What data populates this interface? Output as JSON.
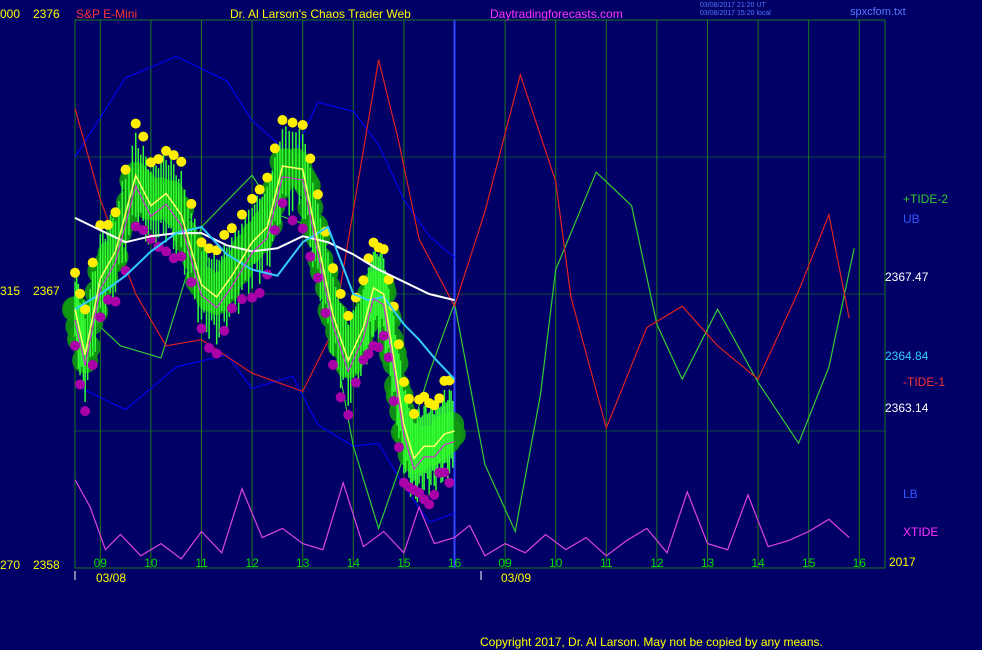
{
  "header": {
    "y_top_left": "000",
    "y_top_price": "2376",
    "instrument": "S&P E-Mini",
    "app_title": "Dr. Al Larson's Chaos Trader Web",
    "site": "Daytradingforecasts.com",
    "stamp_line1": "03/08/2017 21:20 UT",
    "stamp_line2": "03/08/2017 15:20 local",
    "file_name": "spxcfom.txt"
  },
  "y_axis_left": {
    "mid_left": "315",
    "mid_price": "2367",
    "bottom_left": "270",
    "bottom_price": "2358"
  },
  "right_labels": {
    "tide2": "+TIDE-2",
    "ub": "UB",
    "price_a": "2367.47",
    "price_b": "2364.84",
    "tide1": "-TIDE-1",
    "price_c": "2363.14",
    "lb": "LB",
    "xtide": "XTIDE",
    "year": "2017"
  },
  "x_axis": {
    "hours": [
      "09",
      "10",
      "11",
      "12",
      "13",
      "14",
      "15",
      "16",
      "09",
      "10",
      "11",
      "12",
      "13",
      "14",
      "15",
      "16"
    ],
    "dates": [
      "03/08",
      "03/09"
    ]
  },
  "footer": {
    "copyright": "Copyright 2017, Dr. Al Larson. May not be copied by any means."
  },
  "colors": {
    "background": "#000066",
    "grid": "#1a7a1a",
    "price_bar": "#33ff33",
    "price_glow": "#119911",
    "high_dot": "#ffee00",
    "low_dot": "#aa00aa",
    "price_line": "#ffff66",
    "midline": "#cc33cc",
    "cyan_ma": "#33ccff",
    "white_ma": "#ffffff",
    "tide2": "#33cc33",
    "tide1": "#dd2222",
    "bands": "#0000ee",
    "xtide": "#dd44dd",
    "divider": "#3344ff"
  },
  "chart_data": {
    "type": "line",
    "title": "S&P E-Mini",
    "xlabel": "",
    "ylabel": "",
    "ylim": [
      2358,
      2376
    ],
    "x_ticks": [
      "09",
      "10",
      "11",
      "12",
      "13",
      "14",
      "15",
      "16",
      "09",
      "10",
      "11",
      "12",
      "13",
      "14",
      "15",
      "16"
    ],
    "price_readouts": [
      2367.47,
      2364.84,
      2363.14
    ],
    "series": [
      {
        "name": "+TIDE-2",
        "x": [
          8.5,
          9.4,
          10.2,
          11.0,
          12.0,
          12.5,
          13.2,
          14.0,
          14.5,
          15.0,
          15.5,
          16.0,
          16.6,
          17.2,
          17.7,
          18.0,
          18.8,
          19.5,
          20.0,
          20.5,
          21.2,
          22.0,
          22.8,
          23.4,
          23.9
        ],
        "y": [
          2366.7,
          2365.3,
          2364.9,
          2369.2,
          2370.9,
          2369.6,
          2369.2,
          2362.0,
          2359.3,
          2361.7,
          2364.4,
          2366.7,
          2361.4,
          2359.2,
          2363.7,
          2367.8,
          2371.0,
          2369.9,
          2366.0,
          2364.2,
          2366.5,
          2364.1,
          2362.1,
          2364.6,
          2368.5
        ]
      },
      {
        "name": "-TIDE-1",
        "x": [
          8.5,
          9.0,
          9.7,
          10.3,
          11.0,
          12.0,
          13.0,
          13.6,
          14.5,
          14.9,
          15.3,
          16.0,
          16.6,
          17.3,
          18.0,
          18.3,
          19.0,
          19.8,
          20.5,
          21.2,
          22.0,
          22.8,
          23.4,
          23.8
        ],
        "y": [
          2373.1,
          2370.1,
          2367.0,
          2365.3,
          2365.5,
          2364.4,
          2363.8,
          2365.8,
          2374.7,
          2372.0,
          2368.8,
          2366.6,
          2369.7,
          2374.2,
          2370.7,
          2366.9,
          2362.6,
          2365.9,
          2366.6,
          2365.3,
          2364.2,
          2367.1,
          2369.6,
          2366.2
        ]
      },
      {
        "name": "UB",
        "x": [
          8.5,
          9.5,
          10.5,
          11.5,
          12.0,
          12.8,
          13.3,
          14.0,
          14.5,
          15.0,
          15.5,
          16.0
        ],
        "y": [
          2371.5,
          2374.1,
          2374.8,
          2374.0,
          2372.7,
          2371.5,
          2373.3,
          2373.0,
          2371.9,
          2370.1,
          2368.9,
          2368.2
        ]
      },
      {
        "name": "LB",
        "x": [
          8.5,
          9.5,
          10.5,
          11.5,
          12.0,
          12.8,
          13.3,
          14.0,
          14.5,
          15.0,
          15.5,
          16.0
        ],
        "y": [
          2364.0,
          2363.2,
          2364.6,
          2365.0,
          2363.9,
          2364.3,
          2362.7,
          2362.0,
          2362.1,
          2360.7,
          2359.5,
          2359.8
        ]
      },
      {
        "name": "price",
        "x": [
          8.5,
          8.7,
          9.0,
          9.3,
          9.7,
          10.0,
          10.3,
          10.6,
          11.0,
          11.3,
          11.6,
          12.0,
          12.3,
          12.6,
          13.0,
          13.3,
          13.6,
          13.9,
          14.2,
          14.4,
          14.6,
          14.8,
          15.0,
          15.2,
          15.4,
          15.6,
          15.8,
          16.0
        ],
        "y": [
          2366.5,
          2365.0,
          2367.5,
          2368.4,
          2370.9,
          2369.9,
          2370.3,
          2369.6,
          2367.3,
          2366.9,
          2367.6,
          2368.7,
          2369.2,
          2371.2,
          2371.1,
          2368.7,
          2366.3,
          2364.8,
          2365.9,
          2367.2,
          2367.0,
          2364.9,
          2362.7,
          2361.6,
          2362.0,
          2362.0,
          2362.4,
          2362.5
        ]
      },
      {
        "name": "white",
        "x": [
          8.5,
          9.0,
          9.5,
          10.0,
          10.5,
          11.0,
          11.5,
          12.0,
          12.5,
          13.0,
          13.5,
          14.0,
          14.5,
          15.0,
          15.5,
          16.0
        ],
        "y": [
          2369.5,
          2369.1,
          2368.7,
          2368.9,
          2369.0,
          2369.0,
          2368.6,
          2368.4,
          2368.5,
          2368.9,
          2368.7,
          2368.3,
          2367.8,
          2367.4,
          2367.0,
          2366.8
        ]
      },
      {
        "name": "cyan",
        "x": [
          8.5,
          9.0,
          9.5,
          10.0,
          10.5,
          11.0,
          11.5,
          12.0,
          12.5,
          13.0,
          13.5,
          14.0,
          14.3,
          14.6,
          15.0,
          15.3,
          15.6,
          16.0
        ],
        "y": [
          2366.5,
          2367.0,
          2367.6,
          2368.4,
          2369.0,
          2369.2,
          2368.3,
          2367.8,
          2367.6,
          2368.7,
          2369.2,
          2367.0,
          2366.8,
          2366.9,
          2366.0,
          2365.5,
          2364.9,
          2364.2
        ]
      },
      {
        "name": "XTIDE",
        "x": [
          8.5,
          8.8,
          9.1,
          9.4,
          9.8,
          10.2,
          10.6,
          11.0,
          11.4,
          11.8,
          12.2,
          12.6,
          13.0,
          13.4,
          13.8,
          14.2,
          14.6,
          15.0,
          15.3,
          15.6,
          16.0,
          16.3,
          16.6,
          17.0,
          17.4,
          17.8,
          18.2,
          18.6,
          19.0,
          19.4,
          19.8,
          20.2,
          20.6,
          21.0,
          21.4,
          21.8,
          22.2,
          22.6,
          23.0,
          23.4,
          23.8
        ],
        "y": [
          2360.9,
          2360.0,
          2358.6,
          2359.1,
          2358.4,
          2358.8,
          2358.3,
          2359.2,
          2358.5,
          2360.6,
          2359.0,
          2359.3,
          2358.8,
          2358.6,
          2360.8,
          2358.7,
          2359.2,
          2358.5,
          2360.0,
          2358.8,
          2359.0,
          2359.4,
          2358.4,
          2358.8,
          2358.5,
          2359.1,
          2358.6,
          2359.0,
          2358.4,
          2358.9,
          2359.3,
          2358.5,
          2360.5,
          2358.8,
          2358.6,
          2360.4,
          2358.7,
          2358.9,
          2359.2,
          2359.6,
          2359.0
        ]
      }
    ]
  }
}
